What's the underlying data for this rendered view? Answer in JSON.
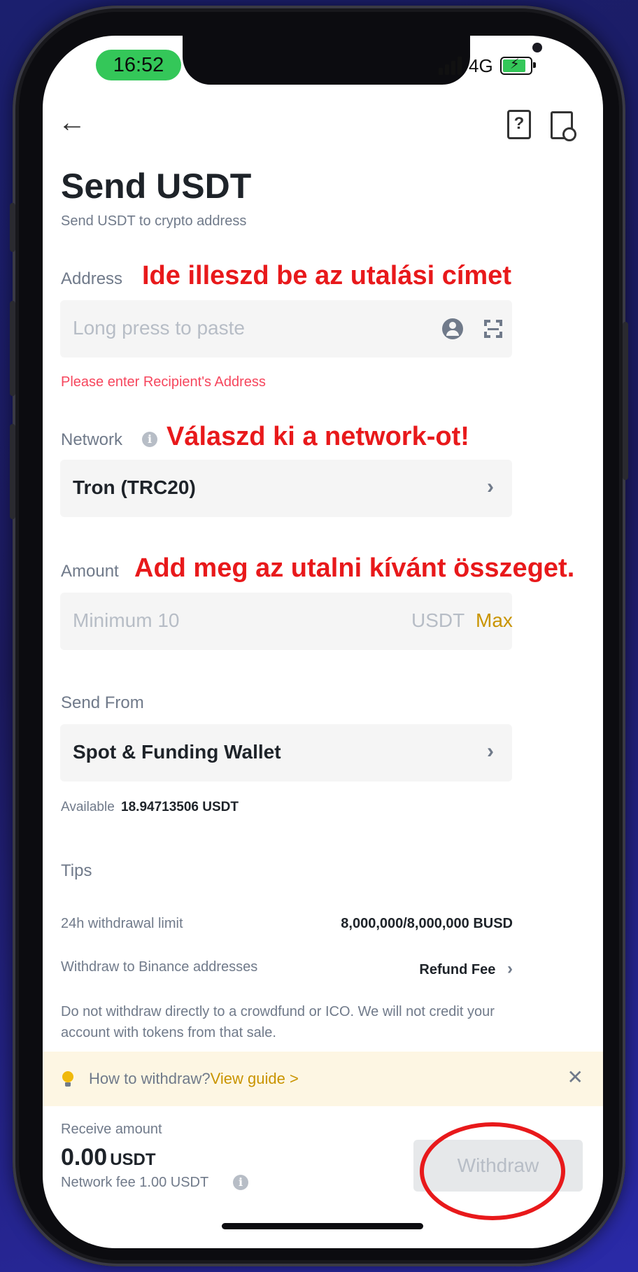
{
  "status_bar": {
    "time": "16:52",
    "network": "4G"
  },
  "header": {
    "title": "Send USDT",
    "subtitle": "Send USDT to crypto address"
  },
  "address": {
    "label": "Address",
    "annotation": "Ide illeszd be az utalási címet",
    "placeholder": "Long press to paste",
    "error": "Please enter Recipient's Address"
  },
  "network": {
    "label": "Network",
    "annotation": "Válaszd ki a network-ot!",
    "value": "Tron (TRC20)"
  },
  "amount": {
    "label": "Amount",
    "annotation": "Add meg az utalni kívánt összeget.",
    "placeholder": "Minimum 10",
    "unit": "USDT",
    "max_label": "Max"
  },
  "send_from": {
    "label": "Send From",
    "value": "Spot & Funding Wallet",
    "available_label": "Available",
    "available_value": "18.94713506 USDT"
  },
  "tips": {
    "title": "Tips",
    "limit_label": "24h withdrawal limit",
    "limit_value": "8,000,000/8,000,000 BUSD",
    "binance_label": "Withdraw to Binance addresses",
    "binance_value": "Refund Fee",
    "note": "Do not withdraw directly to a crowdfund or ICO. We will not credit your account with tokens from that sale."
  },
  "guide": {
    "text": "How to withdraw?",
    "link": "View guide >",
    "close": "✕"
  },
  "footer": {
    "receive_label": "Receive amount",
    "receive_value": "0.00",
    "receive_unit": "USDT",
    "fee": "Network fee 1.00 USDT",
    "withdraw_label": "Withdraw"
  },
  "colors": {
    "accent": "#c99400",
    "annotation": "#e8191b",
    "error": "#f6465d"
  }
}
